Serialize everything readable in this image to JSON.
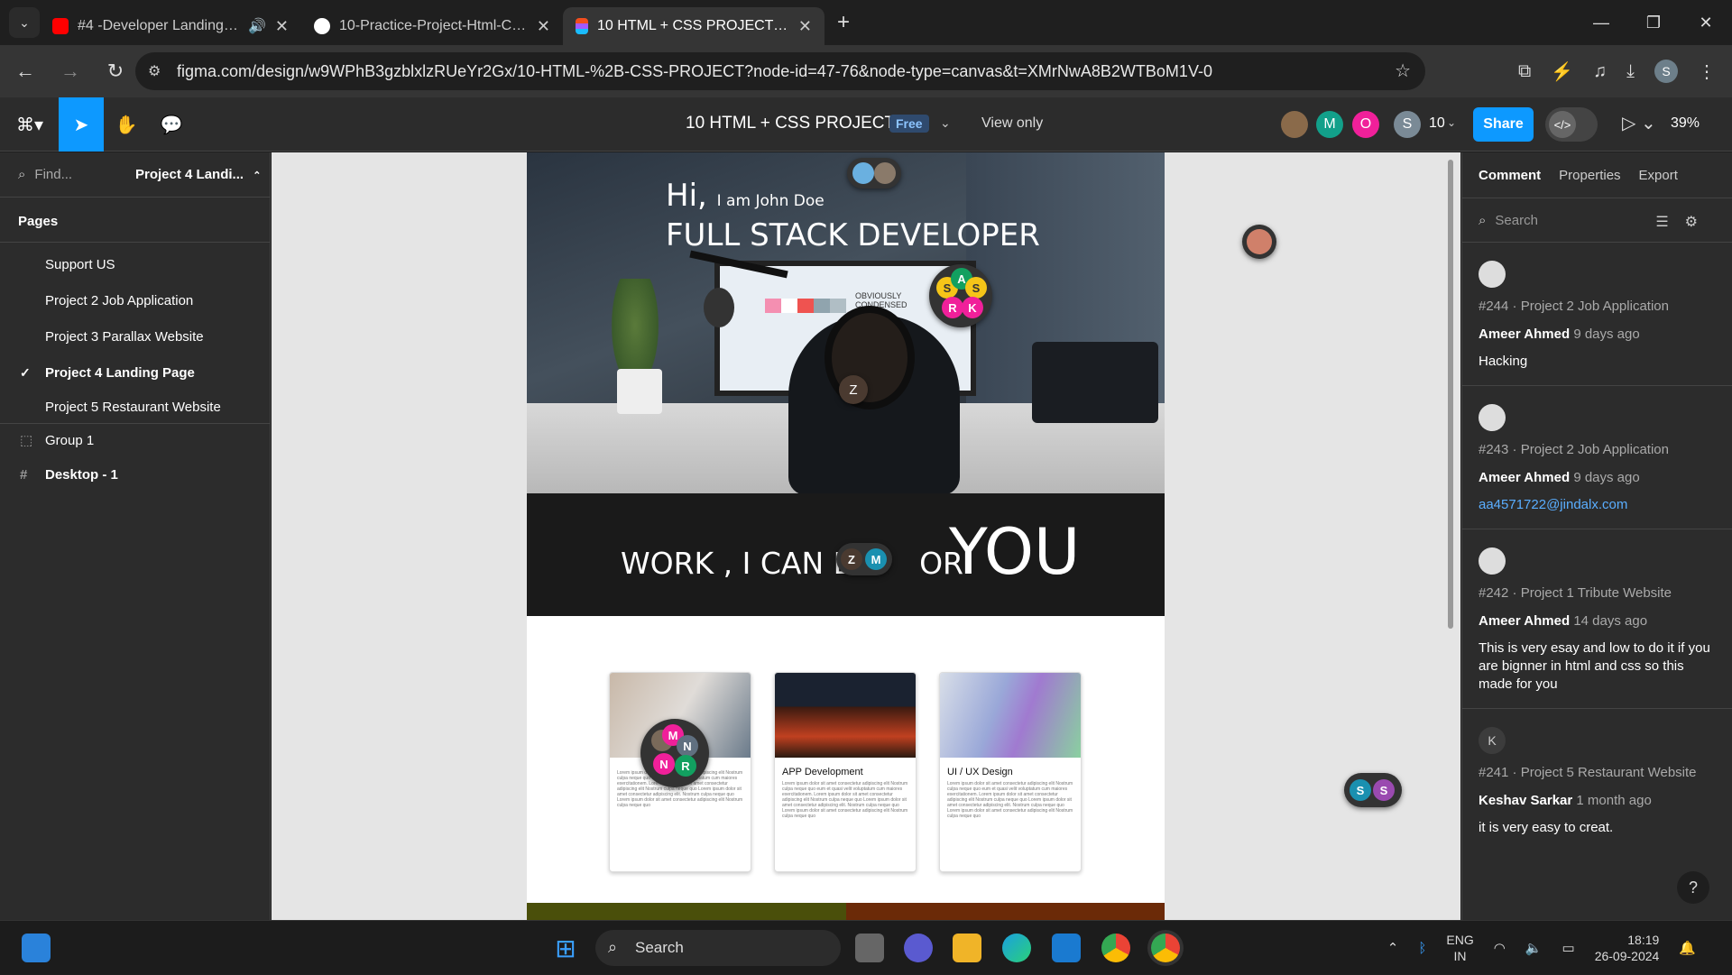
{
  "browser": {
    "tabs": [
      {
        "title": "#4 -Developer Landing Page",
        "icon": "youtube-icon",
        "active": false
      },
      {
        "title": "10-Practice-Project-Html-CSS/P",
        "icon": "github-icon",
        "active": false
      },
      {
        "title": "10 HTML + CSS PROJECT – Figma",
        "icon": "figma-icon",
        "active": true
      }
    ],
    "url": "figma.com/design/w9WPhB3gzblxlzRUeYr2Gx/10-HTML-%2B-CSS-PROJECT?node-id=47-76&node-type=canvas&t=XMrNwA8B2WTBoM1V-0",
    "profile_initial": "S"
  },
  "figma": {
    "file_title": "10 HTML + CSS PROJECT",
    "plan_badge": "Free",
    "view_mode": "View only",
    "collaborator_count": "10",
    "collaborators": [
      {
        "initial": "M",
        "color": "#12a08a"
      },
      {
        "initial": "O",
        "color": "#f0209a"
      },
      {
        "initial": "S",
        "color": "#7a8a96"
      }
    ],
    "share_label": "Share",
    "zoom": "39%",
    "find_placeholder": "Find...",
    "current_page": "Project 4 Landi...",
    "pages_heading": "Pages",
    "pages": [
      {
        "name": "Support US",
        "current": false
      },
      {
        "name": "Project 2 Job Application",
        "current": false
      },
      {
        "name": "Project 3 Parallax Website",
        "current": false
      },
      {
        "name": "Project 4 Landing Page",
        "current": true
      },
      {
        "name": "Project 5 Restaurant Website",
        "current": false
      }
    ],
    "layers": [
      {
        "name": "Group 1",
        "type": "group"
      },
      {
        "name": "Desktop - 1",
        "type": "frame"
      }
    ]
  },
  "design": {
    "hi": "Hi,",
    "intro": "I am John Doe",
    "role": "FULL STACK DEVELOPER",
    "work_text": "WORK , I CAN D",
    "or_text": "OR",
    "you_text": "YOU",
    "monitor_text": "OBVIOUSLY CONDENSED",
    "cards": [
      {
        "title": ""
      },
      {
        "title": "APP Development"
      },
      {
        "title": "UI / UX Design"
      }
    ],
    "lorem": "Lorem ipsum dolor sit amet consectetur adipiscing elit Nostrum culpa neque quo eum et quasi velit voluptatum cum maiores exercitationem. Lorem ipsum dolor sit amet consectetur adipiscing elit Nostrum culpa neque quo Lorem ipsum dolor sit amet consectetur adipiscing elit. Nostrum culpa neque quo Lorem ipsum dolor sit amet consectetur adipiscing elit Nostrum culpa neque quo",
    "footer_colors": [
      "#4a4f0a",
      "#6b2a08"
    ]
  },
  "canvas_cursors": {
    "hero_cluster": [
      "S",
      "A",
      "R",
      "K"
    ],
    "head_cursor": "Z",
    "band_cursors": [
      "Z",
      "M"
    ],
    "card_cluster": [
      "M",
      "N",
      "N",
      "R"
    ],
    "side_cursors": [
      "S",
      "S"
    ]
  },
  "comments_panel": {
    "tabs": [
      "Comment",
      "Properties",
      "Export"
    ],
    "search_placeholder": "Search",
    "comments": [
      {
        "ref": "#244 · Project 2 Job Application",
        "author": "Ameer Ahmed",
        "time": "9 days ago",
        "message": "Hacking",
        "link": false,
        "avatar": ""
      },
      {
        "ref": "#243 · Project 2 Job Application",
        "author": "Ameer Ahmed",
        "time": "9 days ago",
        "message": "aa4571722@jindalx.com",
        "link": true,
        "avatar": ""
      },
      {
        "ref": "#242 · Project 1 Tribute Website",
        "author": "Ameer Ahmed",
        "time": "14 days ago",
        "message": "This is very esay and low to do it if you are bignner in html and css so this made for you",
        "link": false,
        "avatar": ""
      },
      {
        "ref": "#241 · Project 5 Restaurant Website",
        "author": "Keshav Sarkar",
        "time": "1 month ago",
        "message": "it is very easy to creat.",
        "link": false,
        "avatar": "K"
      }
    ]
  },
  "taskbar": {
    "search_label": "Search",
    "language": "ENG",
    "region": "IN",
    "time": "18:19",
    "date": "26-09-2024"
  }
}
